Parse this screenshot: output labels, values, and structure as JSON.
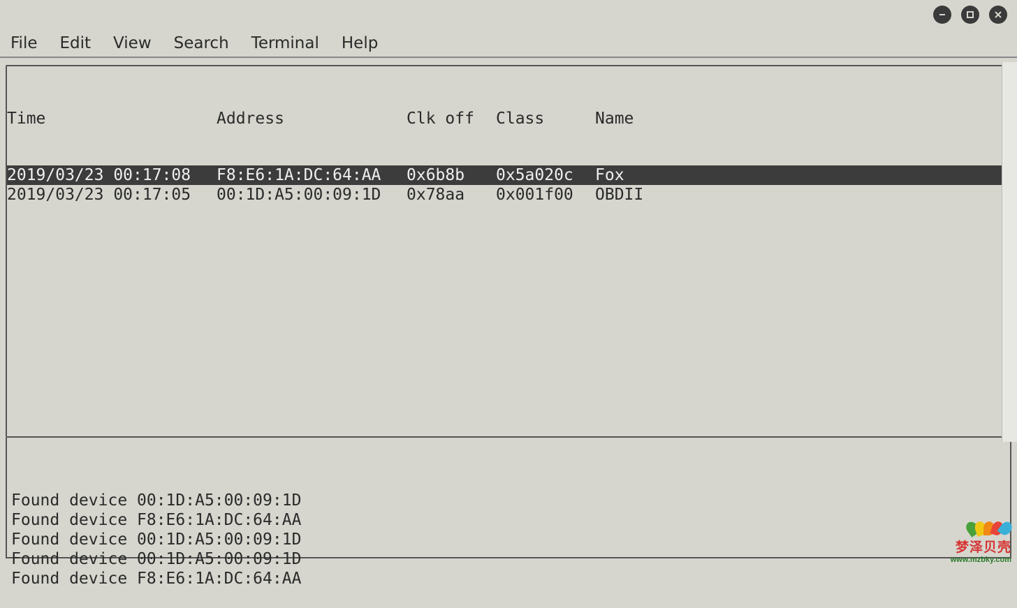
{
  "menubar": {
    "items": [
      "File",
      "Edit",
      "View",
      "Search",
      "Terminal",
      "Help"
    ]
  },
  "table": {
    "headers": {
      "time": "Time",
      "address": "Address",
      "clk_off": "Clk off",
      "class": "Class",
      "name": "Name"
    },
    "rows": [
      {
        "time": "2019/03/23 00:17:08",
        "address": "F8:E6:1A:DC:64:AA",
        "clk_off": "0x6b8b",
        "class": "0x5a020c",
        "name": "Fox",
        "selected": true
      },
      {
        "time": "2019/03/23 00:17:05",
        "address": "00:1D:A5:00:09:1D",
        "clk_off": "0x78aa",
        "class": "0x001f00",
        "name": "OBDII",
        "selected": false
      }
    ]
  },
  "log_lines": [
    "Found device 00:1D:A5:00:09:1D",
    "Found device F8:E6:1A:DC:64:AA",
    "Found device 00:1D:A5:00:09:1D",
    "Found device 00:1D:A5:00:09:1D",
    "Found device F8:E6:1A:DC:64:AA"
  ],
  "watermark": {
    "cn_text": "梦泽贝壳",
    "url": "www.mzbky.com",
    "petal_colors": [
      "#4aa03a",
      "#f0c814",
      "#f08a14",
      "#e8443a",
      "#3ab0d8"
    ]
  }
}
